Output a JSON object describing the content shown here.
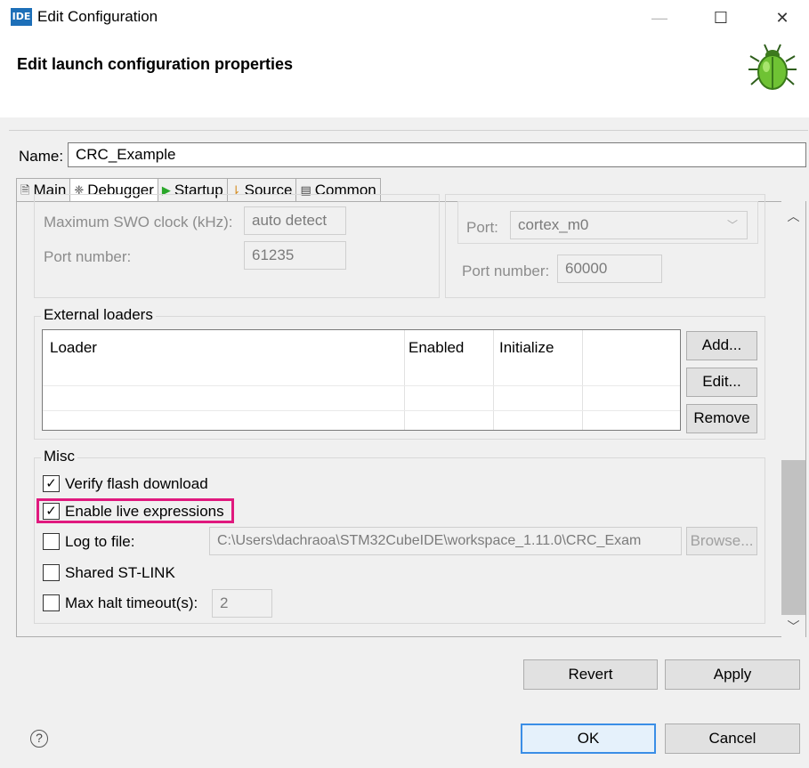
{
  "window": {
    "app_badge": "IDE",
    "title": "Edit Configuration",
    "minimize_glyph": "—",
    "maximize_glyph": "☐",
    "close_glyph": "✕"
  },
  "header": {
    "title": "Edit launch configuration properties",
    "icon": "bug-icon"
  },
  "name_row": {
    "label": "Name:",
    "value": "CRC_Example"
  },
  "tabs": [
    {
      "label": "Main",
      "icon": "main-tab-icon",
      "glyph": "🗎"
    },
    {
      "label": "Debugger",
      "icon": "debugger-tab-icon",
      "glyph": "❈",
      "active": true
    },
    {
      "label": "Startup",
      "icon": "startup-tab-icon",
      "glyph": "▶"
    },
    {
      "label": "Source",
      "icon": "source-tab-icon",
      "glyph": "⇂"
    },
    {
      "label": "Common",
      "icon": "common-tab-icon",
      "glyph": "▤"
    }
  ],
  "swo": {
    "max_clock_label": "Maximum SWO clock (kHz):",
    "max_clock_value": "auto detect",
    "port_number_label": "Port number:",
    "port_number_value": "61235"
  },
  "swv": {
    "port_label": "Port:",
    "port_value": "cortex_m0",
    "port_number_label": "Port number:",
    "port_number_value": "60000"
  },
  "external_loaders": {
    "legend": "External loaders",
    "columns": [
      "Loader",
      "Enabled",
      "Initialize"
    ],
    "rows": [],
    "buttons": {
      "add": "Add...",
      "edit": "Edit...",
      "remove": "Remove"
    }
  },
  "misc": {
    "legend": "Misc",
    "verify_flash": {
      "label": "Verify flash download",
      "checked": true
    },
    "live_expressions": {
      "label": "Enable live expressions",
      "checked": true,
      "highlight_color": "#e0197e"
    },
    "log_to_file": {
      "label": "Log to file:",
      "checked": false,
      "path": "C:\\Users\\dachraoa\\STM32CubeIDE\\workspace_1.11.0\\CRC_Exam",
      "browse_label": "Browse..."
    },
    "shared_stlink": {
      "label": "Shared ST-LINK",
      "checked": false
    },
    "max_halt_timeout": {
      "label": "Max halt timeout(s):",
      "checked": false,
      "value": "2"
    }
  },
  "actions": {
    "revert": "Revert",
    "apply": "Apply"
  },
  "dialog_buttons": {
    "ok": "OK",
    "cancel": "Cancel",
    "help_glyph": "?"
  },
  "colors": {
    "accent_default_button": "#3a8ee6",
    "highlight": "#e0197e"
  }
}
